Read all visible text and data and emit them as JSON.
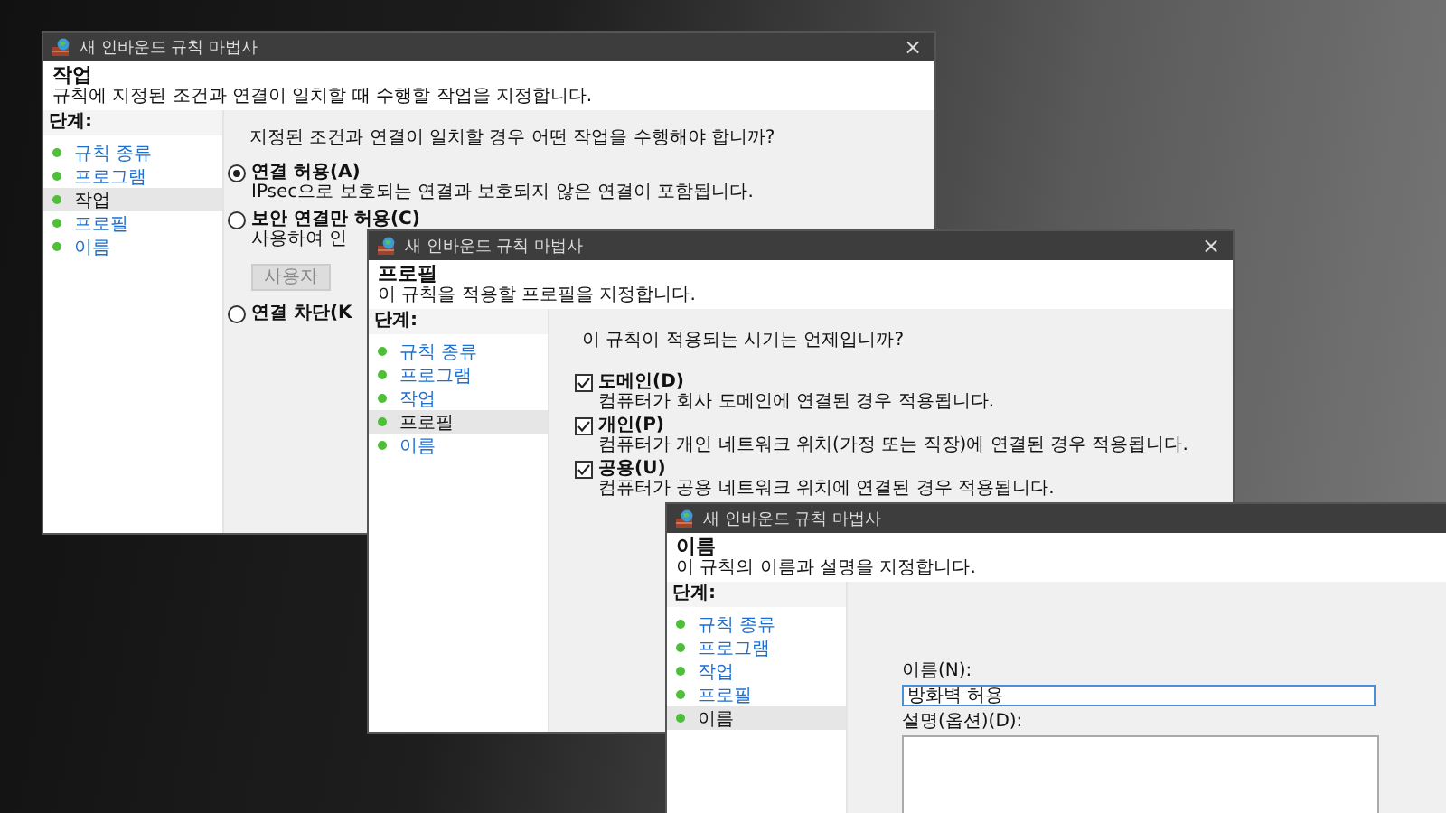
{
  "windows": [
    {
      "title": "새 인바운드 규칙 마법사",
      "close": "×",
      "heading": "작업",
      "subtitle": "규칙에 지정된 조건과 연결이 일치할 때 수행할 작업을 지정합니다.",
      "steps_label": "단계:",
      "steps": [
        {
          "label": "규칙 종류",
          "selected": false
        },
        {
          "label": "프로그램",
          "selected": false
        },
        {
          "label": "작업",
          "selected": true
        },
        {
          "label": "프로필",
          "selected": false
        },
        {
          "label": "이름",
          "selected": false
        }
      ],
      "content": {
        "kind": "radios",
        "question": "지정된 조건과 연결이 일치할 경우 어떤 작업을 수행해야 합니까?",
        "options": [
          {
            "label": "연결 허용(A)",
            "selected": true,
            "description": "IPsec으로 보호되는 연결과 보호되지 않은 연결이 포함됩니다."
          },
          {
            "label": "보안 연결만 허용(C)",
            "selected": false,
            "description": "사용하여 인",
            "button": "사용자"
          },
          {
            "label": "연결 차단(K",
            "selected": false
          }
        ]
      }
    },
    {
      "title": "새 인바운드 규칙 마법사",
      "close": "×",
      "heading": "프로필",
      "subtitle": "이 규칙을 적용할 프로필을 지정합니다.",
      "steps_label": "단계:",
      "steps": [
        {
          "label": "규칙 종류",
          "selected": false
        },
        {
          "label": "프로그램",
          "selected": false
        },
        {
          "label": "작업",
          "selected": false
        },
        {
          "label": "프로필",
          "selected": true
        },
        {
          "label": "이름",
          "selected": false
        }
      ],
      "content": {
        "kind": "checks",
        "question": "이 규칙이 적용되는 시기는 언제입니까?",
        "options": [
          {
            "label": "도메인(D)",
            "checked": true,
            "description": "컴퓨터가 회사 도메인에 연결된 경우 적용됩니다."
          },
          {
            "label": "개인(P)",
            "checked": true,
            "description": "컴퓨터가 개인 네트워크 위치(가정 또는 직장)에 연결된 경우 적용됩니다."
          },
          {
            "label": "공용(U)",
            "checked": true,
            "description": "컴퓨터가 공용 네트워크 위치에 연결된 경우 적용됩니다."
          }
        ]
      }
    },
    {
      "title": "새 인바운드 규칙 마법사",
      "heading": "이름",
      "subtitle": "이 규칙의 이름과 설명을 지정합니다.",
      "steps_label": "단계:",
      "steps": [
        {
          "label": "규칙 종류",
          "selected": false
        },
        {
          "label": "프로그램",
          "selected": false
        },
        {
          "label": "작업",
          "selected": false
        },
        {
          "label": "프로필",
          "selected": false
        },
        {
          "label": "이름",
          "selected": true
        }
      ],
      "content": {
        "kind": "name_form",
        "name_label": "이름(N):",
        "name_value": "방화벽 허용",
        "description_label": "설명(옵션)(D):"
      }
    }
  ]
}
